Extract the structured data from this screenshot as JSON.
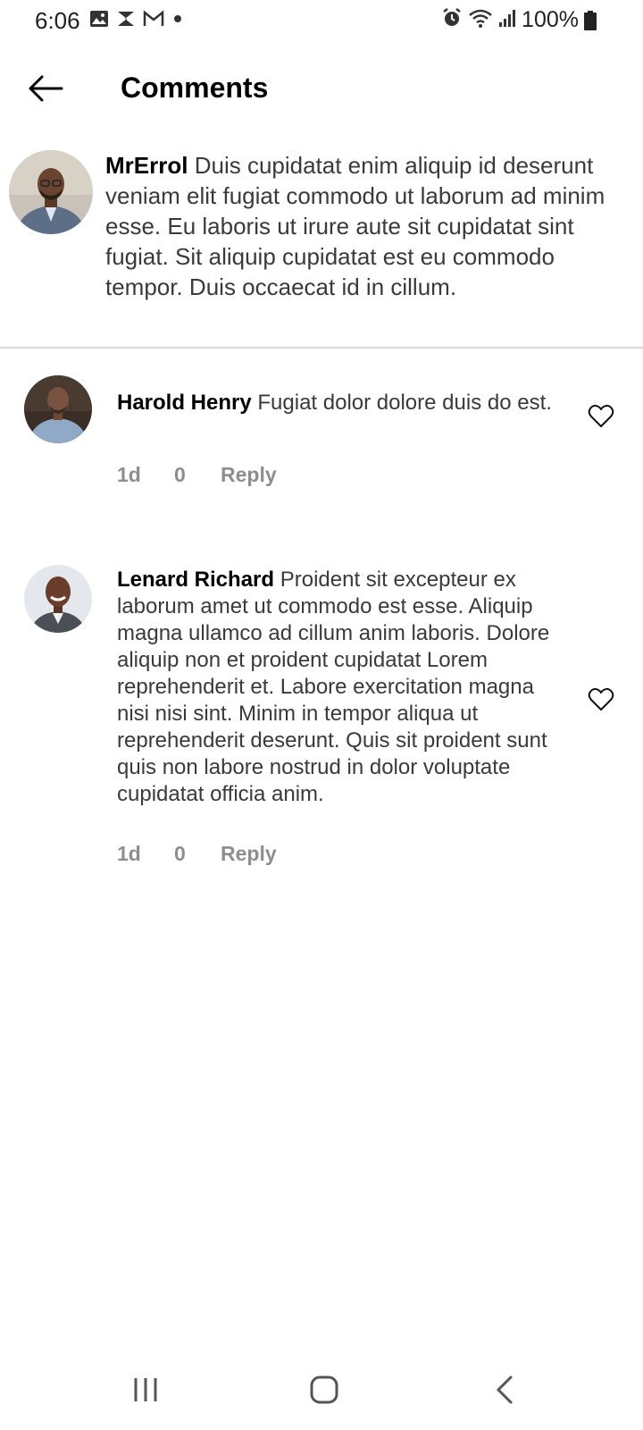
{
  "status_bar": {
    "time": "6:06",
    "left_icons": [
      "image-icon",
      "s-app-icon",
      "gmail-icon",
      "dot-icon"
    ],
    "right_icons": [
      "alarm-icon",
      "wifi-icon",
      "signal-icon"
    ],
    "battery": "100%"
  },
  "header": {
    "back_icon": "arrow-left-icon",
    "title": "Comments"
  },
  "post": {
    "username": "MrErrol",
    "text": "Duis cupidatat enim aliquip id deserunt veniam elit fugiat commodo ut laborum ad minim esse. Eu laboris ut irure aute sit cupidatat sint fugiat. Sit aliquip cupidatat est eu commodo tempor. Duis occaecat id in cillum."
  },
  "comments": [
    {
      "username": "Harold Henry",
      "text": "Fugiat dolor dolore duis do est.",
      "time": "1d",
      "likes": "0",
      "reply_label": "Reply"
    },
    {
      "username": "Lenard Richard",
      "text": "Proident sit excepteur ex laborum amet ut commodo est esse. Aliquip magna ullamco ad cillum anim laboris. Dolore aliquip non et proident cupidatat Lorem reprehenderit et. Labore exercitation magna nisi nisi sint. Minim in tempor aliqua ut reprehenderit deserunt. Quis sit proident sunt quis non labore nostrud in dolor voluptate cupidatat officia anim.",
      "time": "1d",
      "likes": "0",
      "reply_label": "Reply"
    }
  ],
  "nav_bar": {
    "icons": [
      "recent-apps-icon",
      "home-icon",
      "back-icon"
    ]
  },
  "colors": {
    "text_primary": "#000000",
    "text_body": "#3a3a3a",
    "text_meta": "#8e8e8e",
    "divider": "#d7d7d7"
  }
}
